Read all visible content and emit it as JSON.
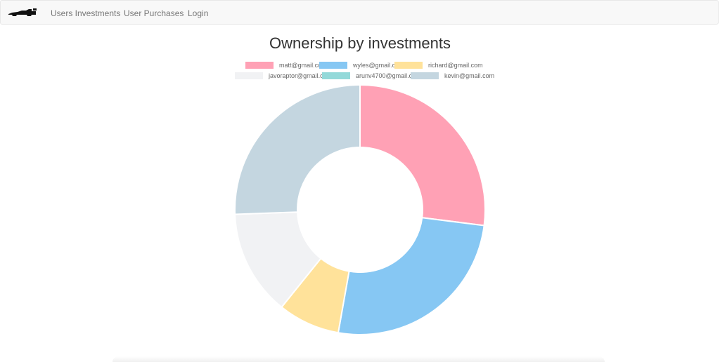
{
  "nav": {
    "brand_icon": "race-car-logo-icon",
    "links": [
      {
        "label": "Users Investments"
      },
      {
        "label": "User Purchases"
      },
      {
        "label": "Login"
      }
    ]
  },
  "chart_data": {
    "type": "pie",
    "variant": "doughnut",
    "title": "Ownership by investments",
    "legend_position": "top",
    "categories": [
      "matt@gmail.com",
      "wyles@gmail.com",
      "richard@gmail.com",
      "javoraptor@gmail.com",
      "arunv4700@gmail.com",
      "kevin@gmail.com"
    ],
    "values": [
      28.1,
      26.8,
      8.3,
      14.2,
      0,
      26.6
    ],
    "colors": [
      "#ffa1b5",
      "#86c7f3",
      "#ffe29a",
      "#f1f2f4",
      "#93d9d9",
      "#c4d6e0"
    ]
  }
}
